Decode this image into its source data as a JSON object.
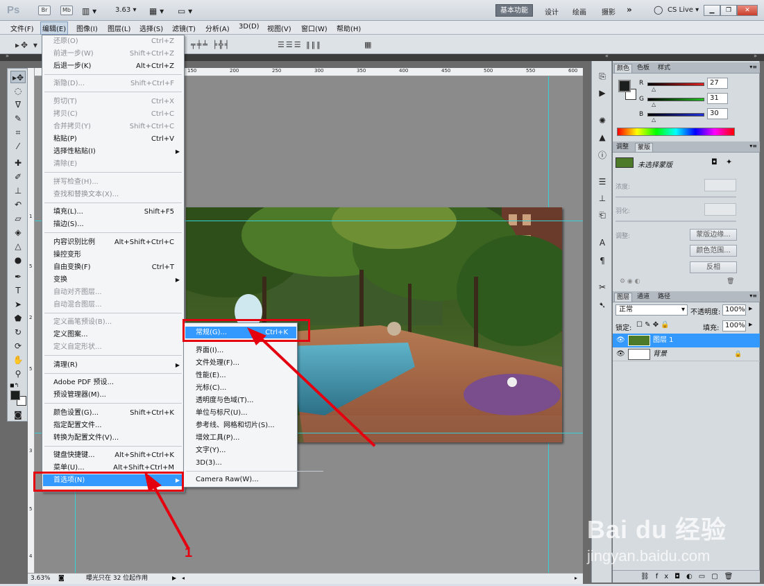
{
  "titlebar": {
    "logo": "Ps",
    "btn_br": "Br",
    "btn_mb": "Mb",
    "zoom": "3.63",
    "workspaces": [
      "基本功能",
      "设计",
      "绘画",
      "摄影"
    ],
    "more": "»",
    "cslive": "CS Live"
  },
  "menubar": [
    "文件(F)",
    "编辑(E)",
    "图像(I)",
    "图层(L)",
    "选择(S)",
    "滤镜(T)",
    "分析(A)",
    "3D(D)",
    "视图(V)",
    "窗口(W)",
    "帮助(H)"
  ],
  "edit_menu": [
    {
      "label": "还原(O)",
      "shortcut": "Ctrl+Z",
      "disabled": true
    },
    {
      "label": "前进一步(W)",
      "shortcut": "Shift+Ctrl+Z",
      "disabled": true
    },
    {
      "label": "后退一步(K)",
      "shortcut": "Alt+Ctrl+Z",
      "disabled": false
    },
    {
      "label": "渐隐(D)...",
      "shortcut": "Shift+Ctrl+F",
      "disabled": true
    },
    {
      "label": "剪切(T)",
      "shortcut": "Ctrl+X",
      "disabled": true
    },
    {
      "label": "拷贝(C)",
      "shortcut": "Ctrl+C",
      "disabled": true
    },
    {
      "label": "合并拷贝(Y)",
      "shortcut": "Shift+Ctrl+C",
      "disabled": true
    },
    {
      "label": "粘贴(P)",
      "shortcut": "Ctrl+V",
      "disabled": false
    },
    {
      "label": "选择性粘贴(I)",
      "shortcut": "",
      "disabled": false,
      "submenu": true
    },
    {
      "label": "清除(E)",
      "shortcut": "",
      "disabled": true
    },
    {
      "label": "拼写检查(H)...",
      "shortcut": "",
      "disabled": true
    },
    {
      "label": "查找和替换文本(X)...",
      "shortcut": "",
      "disabled": true
    },
    {
      "label": "填充(L)...",
      "shortcut": "Shift+F5",
      "disabled": false
    },
    {
      "label": "描边(S)...",
      "shortcut": "",
      "disabled": false
    },
    {
      "label": "内容识别比例",
      "shortcut": "Alt+Shift+Ctrl+C",
      "disabled": false
    },
    {
      "label": "操控变形",
      "shortcut": "",
      "disabled": false
    },
    {
      "label": "自由变换(F)",
      "shortcut": "Ctrl+T",
      "disabled": false
    },
    {
      "label": "变换",
      "shortcut": "",
      "disabled": false,
      "submenu": true
    },
    {
      "label": "自动对齐图层...",
      "shortcut": "",
      "disabled": true
    },
    {
      "label": "自动混合图层...",
      "shortcut": "",
      "disabled": true
    },
    {
      "label": "定义画笔预设(B)...",
      "shortcut": "",
      "disabled": true
    },
    {
      "label": "定义图案...",
      "shortcut": "",
      "disabled": false
    },
    {
      "label": "定义自定形状...",
      "shortcut": "",
      "disabled": true
    },
    {
      "label": "清理(R)",
      "shortcut": "",
      "disabled": false,
      "submenu": true
    },
    {
      "label": "Adobe PDF 预设...",
      "shortcut": "",
      "disabled": false
    },
    {
      "label": "预设管理器(M)...",
      "shortcut": "",
      "disabled": false
    },
    {
      "label": "颜色设置(G)...",
      "shortcut": "Shift+Ctrl+K",
      "disabled": false
    },
    {
      "label": "指定配置文件...",
      "shortcut": "",
      "disabled": false
    },
    {
      "label": "转换为配置文件(V)...",
      "shortcut": "",
      "disabled": false
    },
    {
      "label": "键盘快捷键...",
      "shortcut": "Alt+Shift+Ctrl+K",
      "disabled": false
    },
    {
      "label": "菜单(U)...",
      "shortcut": "Alt+Shift+Ctrl+M",
      "disabled": false
    },
    {
      "label": "首选项(N)",
      "shortcut": "",
      "disabled": false,
      "submenu": true,
      "highlighted": true
    }
  ],
  "prefs_submenu": [
    {
      "label": "常规(G)...",
      "shortcut": "Ctrl+K",
      "highlighted": true
    },
    {
      "label": "界面(I)..."
    },
    {
      "label": "文件处理(F)..."
    },
    {
      "label": "性能(E)..."
    },
    {
      "label": "光标(C)..."
    },
    {
      "label": "透明度与色域(T)..."
    },
    {
      "label": "单位与标尺(U)..."
    },
    {
      "label": "参考线、网格和切片(S)..."
    },
    {
      "label": "增效工具(P)..."
    },
    {
      "label": "文字(Y)..."
    },
    {
      "label": "3D(3)..."
    },
    {
      "label": "Camera Raw(W)..."
    }
  ],
  "ruler_h": [
    "150",
    "200",
    "250",
    "300",
    "350",
    "400",
    "450",
    "500",
    "550",
    "600"
  ],
  "ruler_v": [
    "1",
    "5",
    "2",
    "5",
    "3",
    "5",
    "4"
  ],
  "statusbar": {
    "zoom": "3.63%",
    "info": "曝光只在 32 位起作用"
  },
  "color_panel": {
    "tabs": [
      "颜色",
      "色板",
      "样式"
    ],
    "channels": [
      {
        "name": "R",
        "value": "27",
        "color": "#e02020"
      },
      {
        "name": "G",
        "value": "31",
        "color": "#20c020"
      },
      {
        "name": "B",
        "value": "30",
        "color": "#2030e0"
      }
    ],
    "fg_color": "#1b1f1e"
  },
  "masks_panel": {
    "tabs": [
      "调整",
      "蒙版"
    ],
    "no_mask": "未选择蒙版",
    "density": "浓度:",
    "feather": "羽化:",
    "refine": "调整:",
    "buttons": [
      "蒙版边缘...",
      "颜色范围...",
      "反相"
    ]
  },
  "layers_panel": {
    "tabs": [
      "图层",
      "通道",
      "路径"
    ],
    "blend_mode": "正常",
    "opacity_label": "不透明度:",
    "opacity": "100%",
    "lock_label": "锁定:",
    "fill_label": "填充:",
    "fill": "100%",
    "layers": [
      {
        "name": "图层 1",
        "selected": true
      },
      {
        "name": "背景",
        "selected": false,
        "locked": true
      }
    ]
  },
  "annotation_step": "1",
  "watermark": {
    "brand": "Bai du 经验",
    "url": "jingyan.baidu.com"
  }
}
